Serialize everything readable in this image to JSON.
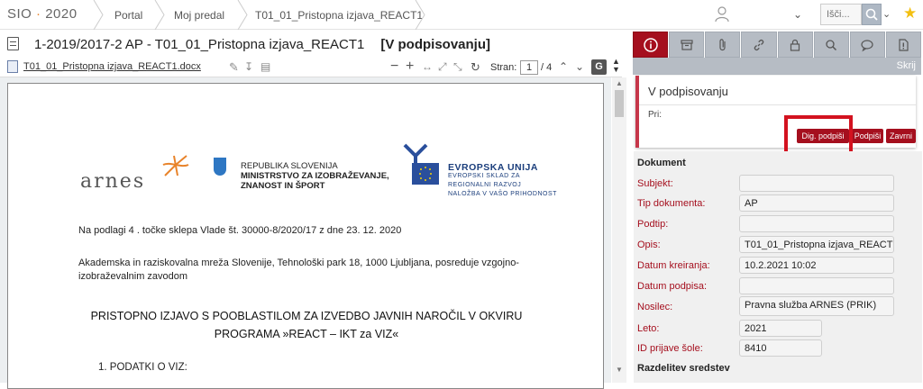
{
  "topbar": {
    "logo_prefix": "SIO",
    "logo_sep": " · ",
    "logo_year": "2020",
    "crumbs": [
      "Portal",
      "Moj predal",
      "T01_01_Pristopna izjava_REACT1"
    ],
    "search_placeholder": "Išči..."
  },
  "title": {
    "prefix": "1-2019/2017-2   AP - T01_01_Pristopna izjava_REACT1",
    "state": "[V podpisovanju]"
  },
  "viewer": {
    "file_name": "T01_01_Pristopna izjava_REACT1.docx",
    "page_label": "Stran:",
    "page_current": "1",
    "page_total": "/ 4",
    "g_label": "G"
  },
  "document": {
    "arnes": "arnes",
    "slo_lines": [
      "REPUBLIKA SLOVENIJA",
      "MINISTRSTVO ZA IZOBRAŽEVANJE,",
      "ZNANOST IN ŠPORT"
    ],
    "eu_lines": [
      "EVROPSKA UNIJA",
      "EVROPSKI SKLAD ZA",
      "REGIONALNI RAZVOJ",
      "NALOŽBA V VAŠO PRIHODNOST"
    ],
    "p1": "Na podlagi  4 . točke sklepa Vlade št. 30000-8/2020/17 z dne 23. 12. 2020",
    "p2a": "Akademska in raziskovalna mreža Slovenije, Tehnološki park 18, 1000 Ljubljana, posreduje vzgojno-",
    "p2b": "izobraževalnim zavodom",
    "h1": "PRISTOPNO IZJAVO S POOBLASTILOM ZA IZVEDBO JAVNIH NAROČIL V OKVIRU",
    "h2": "PROGRAMA »REACT – IKT za VIZ«",
    "h3": "1.    PODATKI O VIZ:"
  },
  "side": {
    "hide_label": "Skrij",
    "panel_title": "V podpisovanju",
    "pri_label": "Pri:",
    "btn_dig": "Dig. podpiši",
    "btn_sign": "Podpiši",
    "btn_close": "Zavrni"
  },
  "meta": {
    "section": "Dokument",
    "section2": "Razdelitev sredstev",
    "rows": [
      {
        "label": "Subjekt:",
        "value": ""
      },
      {
        "label": "Tip dokumenta:",
        "value": "AP"
      },
      {
        "label": "Podtip:",
        "value": ""
      },
      {
        "label": "Opis:",
        "value": "T01_01_Pristopna izjava_REACT1"
      },
      {
        "label": "Datum kreiranja:",
        "value": "10.2.2021 10:02"
      },
      {
        "label": "Datum podpisa:",
        "value": ""
      },
      {
        "label": "Nosilec:",
        "value": "Pravna služba ARNES (PRIK)"
      },
      {
        "label": "Leto:",
        "value": "2021"
      },
      {
        "label": "ID prijave šole:",
        "value": "8410"
      }
    ]
  },
  "colors": {
    "accent": "#a50f1e",
    "tab_gray": "#b6bcc4",
    "logo_orange": "#e8832a",
    "highlight": "#d3121f"
  }
}
